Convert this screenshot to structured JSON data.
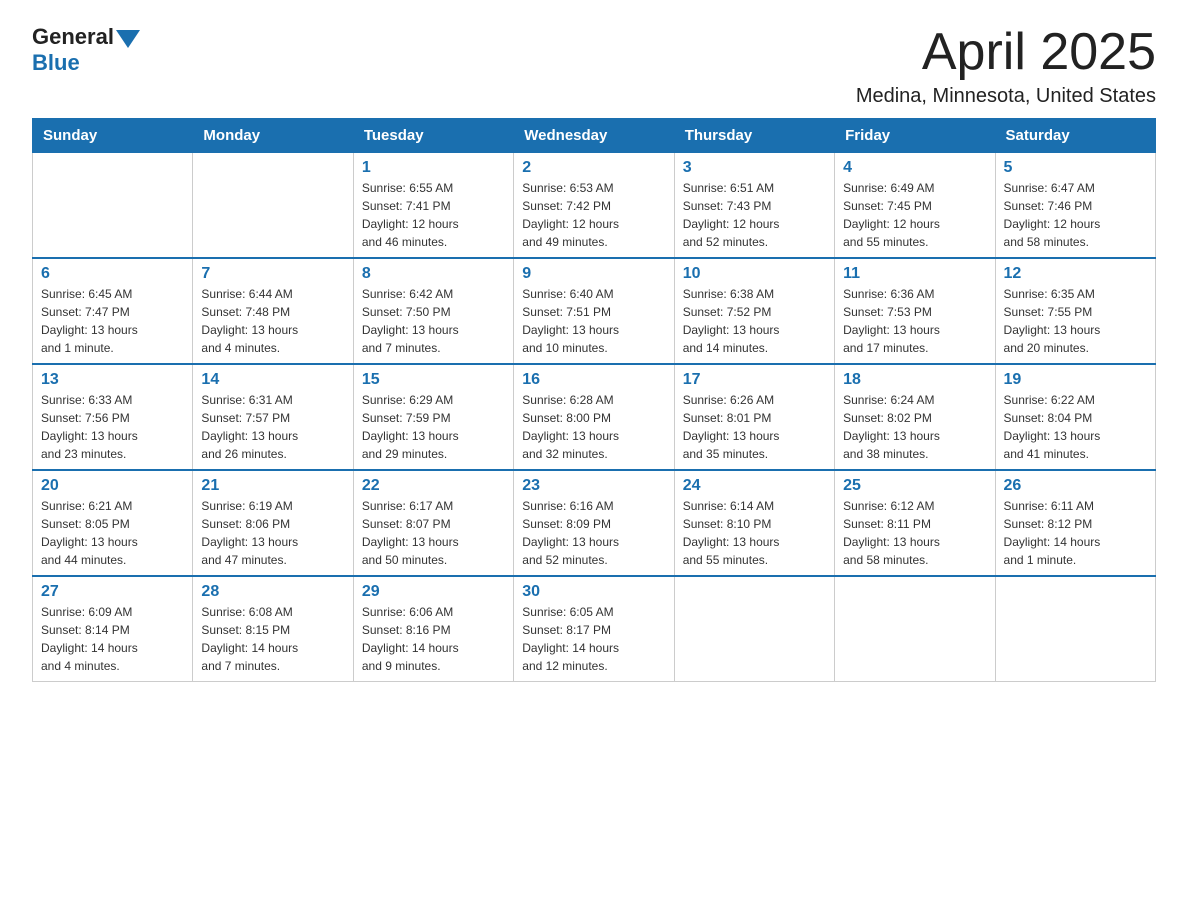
{
  "header": {
    "logo_general": "General",
    "logo_blue": "Blue",
    "month_year": "April 2025",
    "location": "Medina, Minnesota, United States"
  },
  "weekdays": [
    "Sunday",
    "Monday",
    "Tuesday",
    "Wednesday",
    "Thursday",
    "Friday",
    "Saturday"
  ],
  "weeks": [
    [
      {
        "num": "",
        "info": ""
      },
      {
        "num": "",
        "info": ""
      },
      {
        "num": "1",
        "info": "Sunrise: 6:55 AM\nSunset: 7:41 PM\nDaylight: 12 hours\nand 46 minutes."
      },
      {
        "num": "2",
        "info": "Sunrise: 6:53 AM\nSunset: 7:42 PM\nDaylight: 12 hours\nand 49 minutes."
      },
      {
        "num": "3",
        "info": "Sunrise: 6:51 AM\nSunset: 7:43 PM\nDaylight: 12 hours\nand 52 minutes."
      },
      {
        "num": "4",
        "info": "Sunrise: 6:49 AM\nSunset: 7:45 PM\nDaylight: 12 hours\nand 55 minutes."
      },
      {
        "num": "5",
        "info": "Sunrise: 6:47 AM\nSunset: 7:46 PM\nDaylight: 12 hours\nand 58 minutes."
      }
    ],
    [
      {
        "num": "6",
        "info": "Sunrise: 6:45 AM\nSunset: 7:47 PM\nDaylight: 13 hours\nand 1 minute."
      },
      {
        "num": "7",
        "info": "Sunrise: 6:44 AM\nSunset: 7:48 PM\nDaylight: 13 hours\nand 4 minutes."
      },
      {
        "num": "8",
        "info": "Sunrise: 6:42 AM\nSunset: 7:50 PM\nDaylight: 13 hours\nand 7 minutes."
      },
      {
        "num": "9",
        "info": "Sunrise: 6:40 AM\nSunset: 7:51 PM\nDaylight: 13 hours\nand 10 minutes."
      },
      {
        "num": "10",
        "info": "Sunrise: 6:38 AM\nSunset: 7:52 PM\nDaylight: 13 hours\nand 14 minutes."
      },
      {
        "num": "11",
        "info": "Sunrise: 6:36 AM\nSunset: 7:53 PM\nDaylight: 13 hours\nand 17 minutes."
      },
      {
        "num": "12",
        "info": "Sunrise: 6:35 AM\nSunset: 7:55 PM\nDaylight: 13 hours\nand 20 minutes."
      }
    ],
    [
      {
        "num": "13",
        "info": "Sunrise: 6:33 AM\nSunset: 7:56 PM\nDaylight: 13 hours\nand 23 minutes."
      },
      {
        "num": "14",
        "info": "Sunrise: 6:31 AM\nSunset: 7:57 PM\nDaylight: 13 hours\nand 26 minutes."
      },
      {
        "num": "15",
        "info": "Sunrise: 6:29 AM\nSunset: 7:59 PM\nDaylight: 13 hours\nand 29 minutes."
      },
      {
        "num": "16",
        "info": "Sunrise: 6:28 AM\nSunset: 8:00 PM\nDaylight: 13 hours\nand 32 minutes."
      },
      {
        "num": "17",
        "info": "Sunrise: 6:26 AM\nSunset: 8:01 PM\nDaylight: 13 hours\nand 35 minutes."
      },
      {
        "num": "18",
        "info": "Sunrise: 6:24 AM\nSunset: 8:02 PM\nDaylight: 13 hours\nand 38 minutes."
      },
      {
        "num": "19",
        "info": "Sunrise: 6:22 AM\nSunset: 8:04 PM\nDaylight: 13 hours\nand 41 minutes."
      }
    ],
    [
      {
        "num": "20",
        "info": "Sunrise: 6:21 AM\nSunset: 8:05 PM\nDaylight: 13 hours\nand 44 minutes."
      },
      {
        "num": "21",
        "info": "Sunrise: 6:19 AM\nSunset: 8:06 PM\nDaylight: 13 hours\nand 47 minutes."
      },
      {
        "num": "22",
        "info": "Sunrise: 6:17 AM\nSunset: 8:07 PM\nDaylight: 13 hours\nand 50 minutes."
      },
      {
        "num": "23",
        "info": "Sunrise: 6:16 AM\nSunset: 8:09 PM\nDaylight: 13 hours\nand 52 minutes."
      },
      {
        "num": "24",
        "info": "Sunrise: 6:14 AM\nSunset: 8:10 PM\nDaylight: 13 hours\nand 55 minutes."
      },
      {
        "num": "25",
        "info": "Sunrise: 6:12 AM\nSunset: 8:11 PM\nDaylight: 13 hours\nand 58 minutes."
      },
      {
        "num": "26",
        "info": "Sunrise: 6:11 AM\nSunset: 8:12 PM\nDaylight: 14 hours\nand 1 minute."
      }
    ],
    [
      {
        "num": "27",
        "info": "Sunrise: 6:09 AM\nSunset: 8:14 PM\nDaylight: 14 hours\nand 4 minutes."
      },
      {
        "num": "28",
        "info": "Sunrise: 6:08 AM\nSunset: 8:15 PM\nDaylight: 14 hours\nand 7 minutes."
      },
      {
        "num": "29",
        "info": "Sunrise: 6:06 AM\nSunset: 8:16 PM\nDaylight: 14 hours\nand 9 minutes."
      },
      {
        "num": "30",
        "info": "Sunrise: 6:05 AM\nSunset: 8:17 PM\nDaylight: 14 hours\nand 12 minutes."
      },
      {
        "num": "",
        "info": ""
      },
      {
        "num": "",
        "info": ""
      },
      {
        "num": "",
        "info": ""
      }
    ]
  ]
}
